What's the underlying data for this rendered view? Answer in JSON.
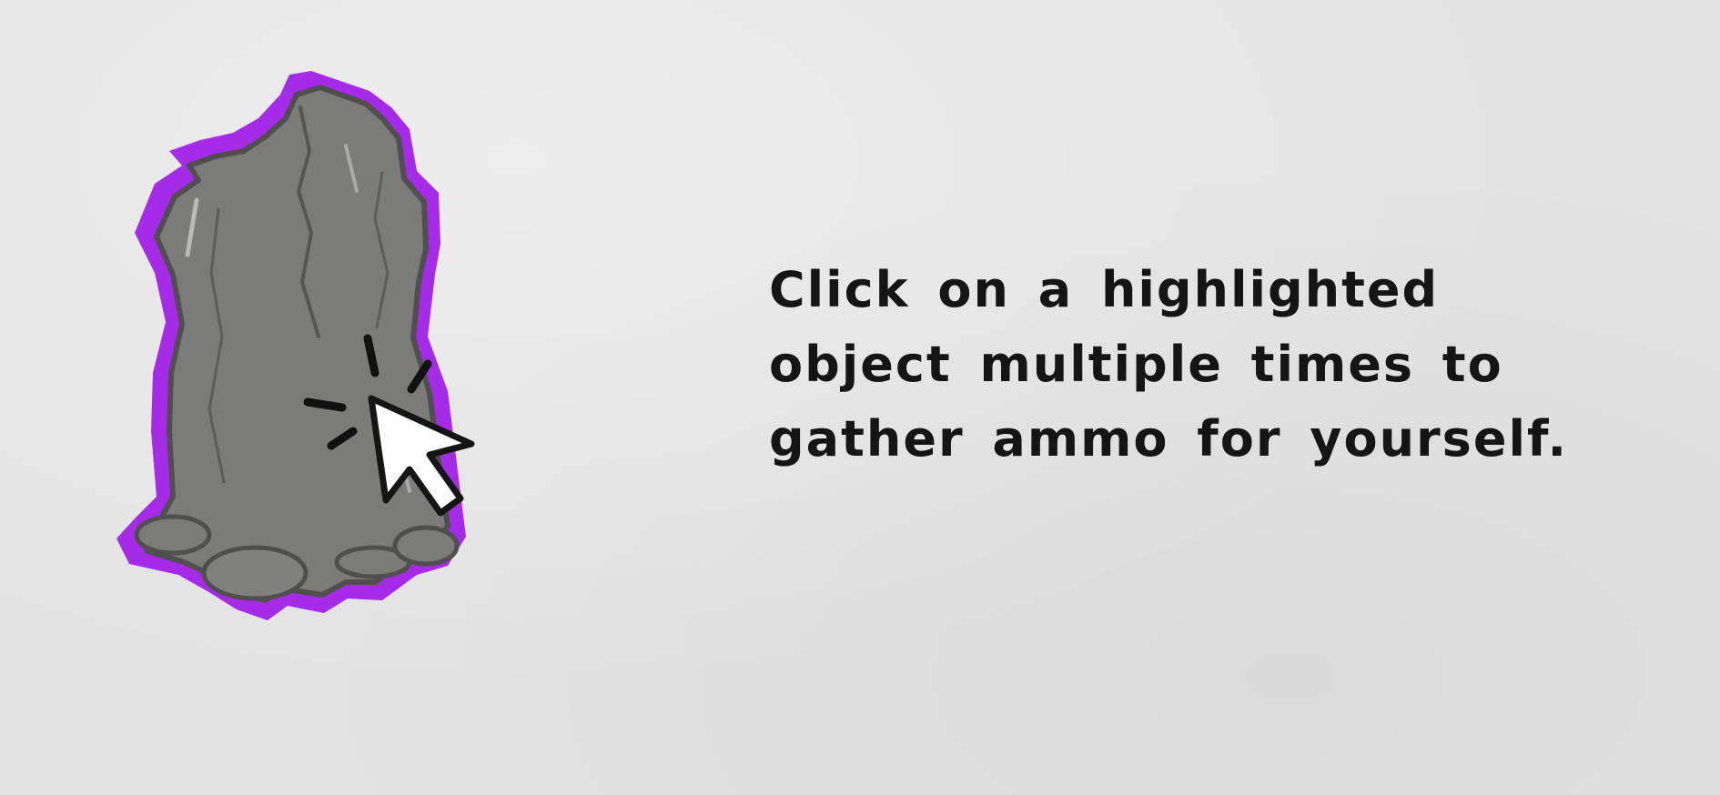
{
  "tutorial": {
    "instruction_text": "Click on a highlighted object multiple times to gather ammo for yourself."
  },
  "illustration": {
    "object_name": "highlighted-rock",
    "icon": "mouse-cursor-icon",
    "highlight_color": "#a52be8",
    "rock_color": "#7b7c7a",
    "rock_outline_color": "#4f504e"
  }
}
